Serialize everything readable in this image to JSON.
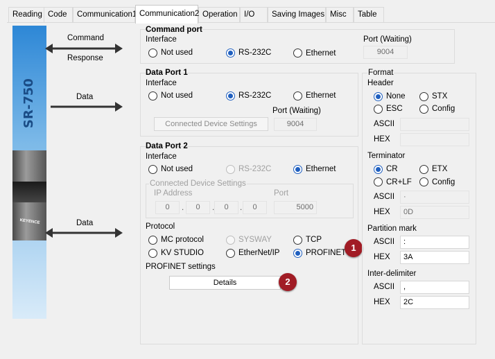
{
  "tabs": [
    {
      "label": "Reading",
      "active": false
    },
    {
      "label": "Code",
      "active": false
    },
    {
      "label": "Communication1",
      "active": false
    },
    {
      "label": "Communication2",
      "active": true
    },
    {
      "label": "Operation",
      "active": false
    },
    {
      "label": "I/O",
      "active": false
    },
    {
      "label": "Saving Images",
      "active": false
    },
    {
      "label": "Misc",
      "active": false
    },
    {
      "label": "Table",
      "active": false
    }
  ],
  "device": {
    "model": "SR-750",
    "brand": "KEYENCE",
    "arrow_command": "Command",
    "arrow_response": "Response",
    "arrow_data1": "Data",
    "arrow_data2": "Data"
  },
  "command_port": {
    "title": "Command port",
    "interface_label": "Interface",
    "options": [
      "Not used",
      "RS-232C",
      "Ethernet"
    ],
    "selected": "RS-232C",
    "port_label": "Port (Waiting)",
    "port_value": "9004"
  },
  "data_port1": {
    "title": "Data Port 1",
    "interface_label": "Interface",
    "options": [
      "Not used",
      "RS-232C",
      "Ethernet"
    ],
    "selected": "RS-232C",
    "connected_btn": "Connected Device Settings",
    "port_label": "Port (Waiting)",
    "port_value": "9004"
  },
  "data_port2": {
    "title": "Data Port 2",
    "interface_label": "Interface",
    "options": [
      "Not used",
      "RS-232C",
      "Ethernet"
    ],
    "selected": "Ethernet",
    "connected_group_label": "Connected Device Settings",
    "ip_label": "IP Address",
    "ip_octets": [
      "0",
      "0",
      "0",
      "0"
    ],
    "ip_sep": ".",
    "port_label": "Port",
    "port_value": "5000",
    "protocol_label": "Protocol",
    "protocols": [
      "MC protocol",
      "SYSWAY",
      "TCP",
      "KV STUDIO",
      "EtherNet/IP",
      "PROFINET"
    ],
    "selected_protocol": "PROFINET",
    "profinet_label": "PROFINET settings",
    "details_btn": "Details"
  },
  "format": {
    "title": "Format",
    "header_label": "Header",
    "header_options": [
      "None",
      "STX",
      "ESC",
      "Config"
    ],
    "header_selected": "None",
    "header_ascii_label": "ASCII",
    "header_hex_label": "HEX",
    "header_ascii": "",
    "header_hex": "",
    "terminator_label": "Terminator",
    "terminator_options": [
      "CR",
      "ETX",
      "CR+LF",
      "Config"
    ],
    "terminator_selected": "CR",
    "term_ascii_label": "ASCII",
    "term_hex_label": "HEX",
    "term_ascii": "·",
    "term_hex": "0D",
    "partition_label": "Partition mark",
    "part_ascii_label": "ASCII",
    "part_hex_label": "HEX",
    "part_ascii": ":",
    "part_hex": "3A",
    "inter_label": "Inter-delimiter",
    "inter_ascii_label": "ASCII",
    "inter_hex_label": "HEX",
    "inter_ascii": ",",
    "inter_hex": "2C"
  },
  "markers": [
    "1",
    "2"
  ],
  "colors": {
    "radio_selected": "#1f5fbf",
    "marker": "#a11c25",
    "device_blue": "#2d87d6"
  }
}
